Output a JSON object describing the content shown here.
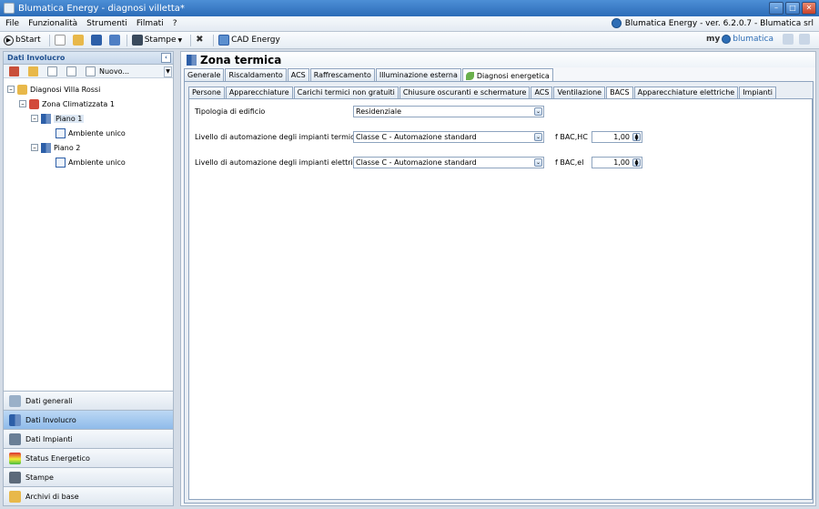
{
  "window": {
    "title": "Blumatica Energy - diagnosi villetta*"
  },
  "menu": {
    "items": [
      "File",
      "Funzionalità",
      "Strumenti",
      "Filmati",
      "?"
    ],
    "brand": "Blumatica Energy - ver. 6.2.0.7 - Blumatica srl"
  },
  "toolbar": {
    "bstart": "bStart",
    "stampe": "Stampe",
    "cad": "CAD Energy",
    "brand_left": "my",
    "brand_right": "blumatica"
  },
  "left": {
    "header": "Dati Involucro",
    "new_label": "Nuovo...",
    "tree": [
      "Diagnosi Villa Rossi",
      "Zona Climatizzata 1",
      "Piano 1",
      "Ambiente unico",
      "Piano 2",
      "Ambiente unico"
    ],
    "nav": [
      "Dati generali",
      "Dati Involucro",
      "Dati Impianti",
      "Status Energetico",
      "Stampe",
      "Archivi di base"
    ]
  },
  "main": {
    "title": "Zona termica",
    "tabs": [
      "Generale",
      "Riscaldamento",
      "ACS",
      "Raffrescamento",
      "Illuminazione esterna",
      "Diagnosi energetica"
    ],
    "subtabs": [
      "Persone",
      "Apparecchiature",
      "Carichi termici non gratuiti",
      "Chiusure oscuranti e schermature",
      "ACS",
      "Ventilazione",
      "BACS",
      "Apparecchiature elettriche",
      "Impianti"
    ],
    "form": {
      "tipologia_label": "Tipologia di edificio",
      "tipologia_value": "Residenziale",
      "termici_label": "Livello di automazione degli impianti termici",
      "termici_value": "Classe C - Automazione standard",
      "termici_factor_label": "f BAC,HC",
      "termici_factor_value": "1,00",
      "elettrici_label": "Livello di automazione degli impianti elettrici",
      "elettrici_value": "Classe C - Automazione standard",
      "elettrici_factor_label": "f BAC,el",
      "elettrici_factor_value": "1,00"
    }
  }
}
